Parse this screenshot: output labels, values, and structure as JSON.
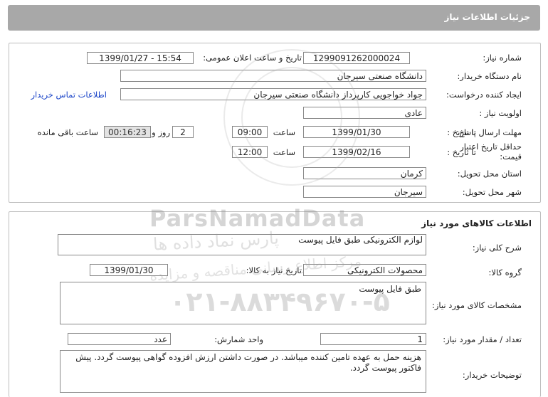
{
  "header": {
    "title": "جزئیات اطلاعات نیاز"
  },
  "need_info": {
    "need_number_label": "شماره نیاز:",
    "need_number": "1299091262000024",
    "announce_label": "تاریخ و ساعت اعلان عمومی:",
    "announce_value": "1399/01/27 - 15:54",
    "buyer_org_label": "نام دستگاه خریدار:",
    "buyer_org": "دانشگاه صنعتی سیرجان",
    "creator_label": "ایجاد کننده درخواست:",
    "creator": "جواد خواجویی کارپرداز دانشگاه صنعتی سیرجان",
    "contact_link": "اطلاعات تماس خریدار",
    "priority_label": "اولویت نیاز :",
    "priority": "عادی",
    "reply_deadline_label": "مهلت ارسال پاسخ:",
    "to_date_label": "تا تاریخ :",
    "reply_date": "1399/01/30",
    "time_label": "ساعت",
    "reply_time": "09:00",
    "days": "2",
    "days_label": "روز و",
    "remaining": "00:16:23",
    "remaining_label": "ساعت باقی مانده",
    "min_validity_label": "حداقل تاریخ اعتبار قیمت:",
    "validity_date": "1399/02/16",
    "validity_time": "12:00",
    "province_label": "استان محل تحویل:",
    "province": "کرمان",
    "city_label": "شهر محل تحویل:",
    "city": "سیرجان"
  },
  "goods": {
    "section_title": "اطلاعات کالاهای مورد نیاز",
    "desc_label": "شرح کلی نیاز:",
    "desc": "لوازم الکترونیکی طبق فایل پیوست",
    "group_label": "گروه کالا:",
    "group": "محصولات الکترونیکی",
    "need_date_label": "تاریخ نیاز به کالا:",
    "need_date": "1399/01/30",
    "spec_label": "مشخصات کالای مورد نیاز:",
    "spec": "طبق فایل پیوست",
    "qty_label": "تعداد / مقدار مورد نیاز:",
    "qty": "1",
    "unit_label": "واحد شمارش:",
    "unit": "عدد",
    "buyer_notes_label": "توضیحات خریدار:",
    "buyer_notes": "هزینه حمل به عهده تامین کننده میباشد. در صورت داشتن ارزش افزوده گواهی پیوست گردد. پیش فاکتور پیوست گردد."
  },
  "watermark": {
    "brand": "ParsNamadData",
    "brand_fa": "پارس نماد داده ها",
    "subtitle": "مرکز اطلاع رسانی مناقصه و مزایده",
    "phone": "۰۲۱-۸۸۳۴۹۶۷۰-۵"
  }
}
